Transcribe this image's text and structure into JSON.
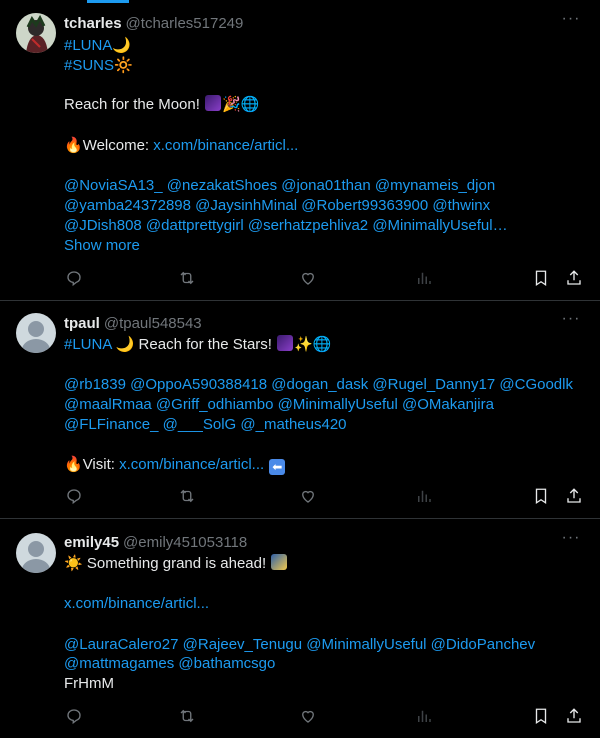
{
  "tweets": [
    {
      "name": "tcharles",
      "handle": "@tcharles517249",
      "more_label": "···",
      "lines": {
        "l1": "#LUNA",
        "l2": "#SUNS",
        "l3": "Reach for the Moon!",
        "l4_label": "Welcome: ",
        "l4_link": "x.com/binance/articl...",
        "l5": "@NoviaSA13_ @nezakatShoes @jona01than @mynameis_djon",
        "l6": "@yamba24372898 @JaysinhMinal @Robert99363900 @thwinx",
        "l7": "@JDish808 @dattprettygirl @serhatzpehliva2 @MinimallyUseful…",
        "show_more": "Show more"
      },
      "emoji": {
        "moon": "🌙",
        "sun": "🔆",
        "fire": "🔥",
        "globe": "🌐",
        "party": "🎉"
      }
    },
    {
      "name": "tpaul",
      "handle": "@tpaul548543",
      "more_label": "···",
      "lines": {
        "l1_tag": "#LUNA",
        "l1_text": " Reach for the Stars! ",
        "l2": "@rb1839 @OppoA590388418 @dogan_dask @Rugel_Danny17 @CGoodlk",
        "l3": "@maalRmaa @Griff_odhiambo @MinimallyUseful @OMakanjira",
        "l4": "@FLFinance_ @___SolG @_matheus420",
        "l5_label": "Visit: ",
        "l5_link": "x.com/binance/articl..."
      },
      "emoji": {
        "moon": "🌙",
        "sparkles": "✨",
        "globe": "🌐",
        "fire": "🔥"
      }
    },
    {
      "name": "emily45",
      "handle": "@emily451053118",
      "more_label": "···",
      "lines": {
        "l1_text": "Something grand is ahead! ",
        "l2_link": "x.com/binance/articl...",
        "l3": "@LauraCalero27 @Rajeev_Tenugu @MinimallyUseful @DidoPanchev",
        "l4": "@mattmagames @bathamcsgo",
        "l5": "FrHmM"
      },
      "emoji": {
        "sun": "☀️"
      }
    }
  ],
  "colors": {
    "background": "#000000",
    "text": "#e7e9ea",
    "muted": "#71767b",
    "link": "#1d9bf0",
    "divider": "#2f3336"
  },
  "icons": [
    "reply-icon",
    "retweet-icon",
    "like-icon",
    "views-icon",
    "bookmark-icon",
    "share-icon",
    "more-icon"
  ]
}
